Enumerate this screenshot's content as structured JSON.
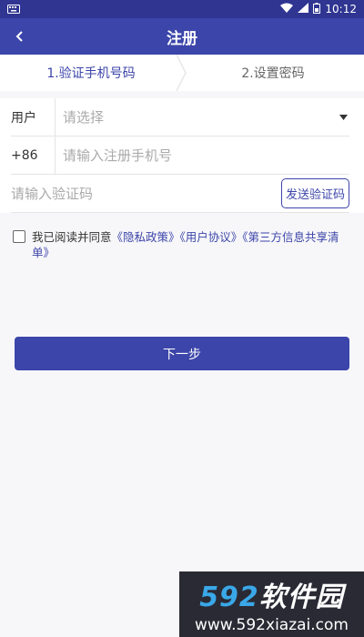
{
  "statusbar": {
    "time": "10:12"
  },
  "appbar": {
    "title": "注册"
  },
  "steps": {
    "step1": "1.验证手机号码",
    "step2": "2.设置密码"
  },
  "form": {
    "user_label": "用户",
    "user_placeholder": "请选择",
    "country_code": "+86",
    "phone_placeholder": "请输入注册手机号",
    "code_placeholder": "请输入验证码",
    "send_code_label": "发送验证码"
  },
  "agreement": {
    "prefix": "我已阅读并同意",
    "privacy": "《隐私政策》",
    "user_agreement": "《用户协议》",
    "third_party": "《第三方信息共享清单》"
  },
  "next_label": "下一步",
  "watermark": {
    "logo_num": "592",
    "logo_text": "软件园",
    "url": "www.592xiazai.com"
  },
  "colors": {
    "primary": "#3c45a9",
    "statusbar": "#2f3591"
  }
}
